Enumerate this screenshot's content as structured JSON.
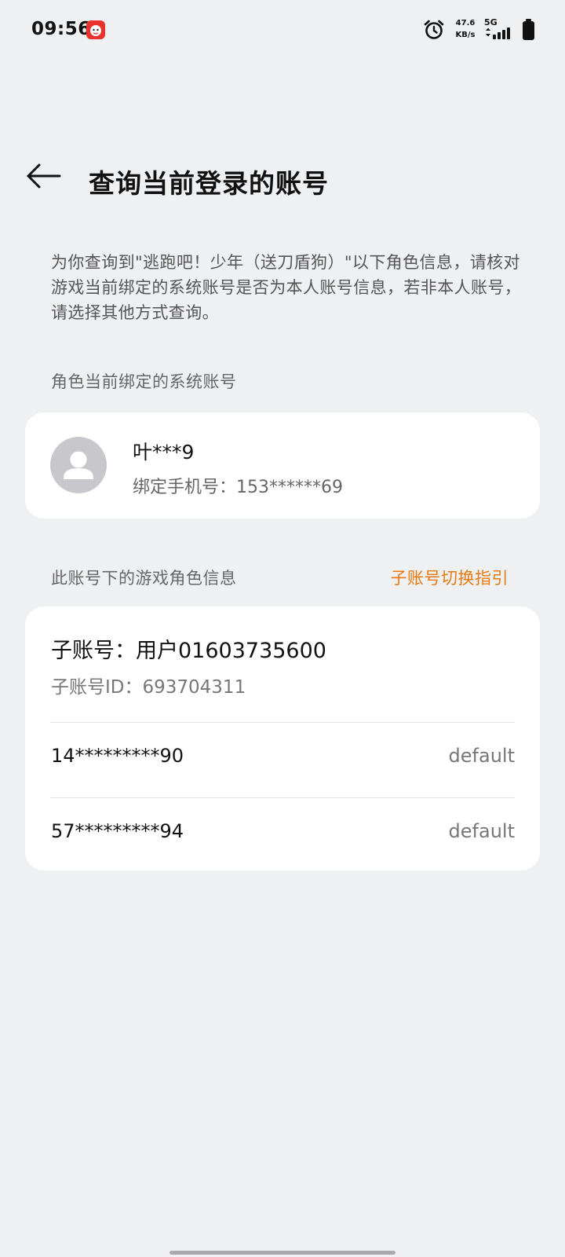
{
  "status_bar": {
    "time": "09:56",
    "speed_value": "47.6",
    "speed_unit": "KB/s",
    "network": "5G",
    "app_icon": "red-app-icon",
    "alarm_icon": "alarm-clock-icon",
    "battery_icon": "battery-icon"
  },
  "header": {
    "back_icon": "back-arrow-icon",
    "title": "查询当前登录的账号"
  },
  "description": "为你查询到\"逃跑吧！少年（送刀盾狗）\"以下角色信息，请核对游戏当前绑定的系统账号是否为本人账号信息，若非本人账号，请选择其他方式查询。",
  "bound_account": {
    "section_label": "角色当前绑定的系统账号",
    "avatar_icon": "avatar-placeholder-icon",
    "name": "叶***9",
    "phone_label": "绑定手机号：",
    "phone": "153******69"
  },
  "roles": {
    "section_label": "此账号下的游戏角色信息",
    "guide_link": "子账号切换指引",
    "sub_account_label": "子账号：",
    "sub_account_name": "用户01603735600",
    "sub_account_id_label": "子账号ID：",
    "sub_account_id": "693704311",
    "items": [
      {
        "id": "14*********90",
        "server": "default"
      },
      {
        "id": "57*********94",
        "server": "default"
      }
    ]
  },
  "colors": {
    "background": "#eff0f2",
    "card": "#ffffff",
    "accent_link": "#e87a10",
    "primary_text": "#111111",
    "secondary_text": "#666666"
  }
}
